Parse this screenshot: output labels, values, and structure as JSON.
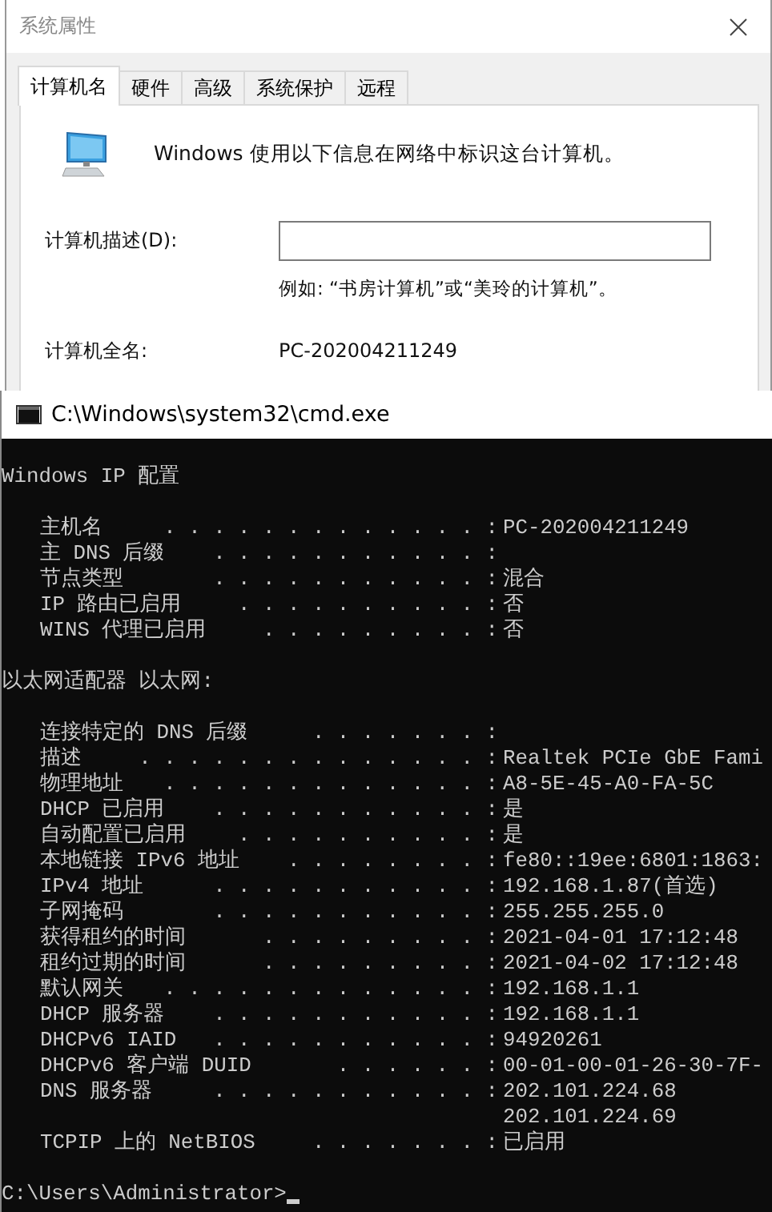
{
  "dialog": {
    "title": "系统属性",
    "tabs": [
      {
        "label": "计算机名",
        "selected": true
      },
      {
        "label": "硬件",
        "selected": false
      },
      {
        "label": "高级",
        "selected": false
      },
      {
        "label": "系统保护",
        "selected": false
      },
      {
        "label": "远程",
        "selected": false
      }
    ],
    "intro": "Windows 使用以下信息在网络中标识这台计算机。",
    "description_label": "计算机描述(D):",
    "example": "例如: “书房计算机”或“美玲的计算机”。",
    "full_name_label": "计算机全名:",
    "full_name": "PC-202004211249"
  },
  "console": {
    "title": "C:\\Windows\\system32\\cmd.exe",
    "lines": [
      {
        "kind": "blank"
      },
      {
        "kind": "heading",
        "text": "Windows IP 配置"
      },
      {
        "kind": "blank"
      },
      {
        "kind": "entry",
        "label": "主机名",
        "leader": ". . . . . . . . . . . . . :",
        "value": "PC-202004211249"
      },
      {
        "kind": "entry",
        "label": "主 DNS 后缀",
        "leader": ". . . . . . . . . . . :"
      },
      {
        "kind": "entry",
        "label": "节点类型",
        "leader": ". . . . . . . . . . . :",
        "value": "混合"
      },
      {
        "kind": "entry",
        "label": "IP 路由已启用",
        "leader": ". . . . . . . . . . :",
        "value": "否"
      },
      {
        "kind": "entry",
        "label": "WINS 代理已启用",
        "leader": ". . . . . . . . . :",
        "value": "否"
      },
      {
        "kind": "blank"
      },
      {
        "kind": "heading",
        "text": "以太网适配器 以太网:"
      },
      {
        "kind": "blank"
      },
      {
        "kind": "entry",
        "label": "连接特定的 DNS 后缀",
        "leader": ". . . . . . . :"
      },
      {
        "kind": "entry",
        "label": "描述",
        "leader": ". . . . . . . . . . . . . . :",
        "value": "Realtek PCIe GbE Fami"
      },
      {
        "kind": "entry",
        "label": "物理地址",
        "leader": ". . . . . . . . . . . . . :",
        "value": "A8-5E-45-A0-FA-5C"
      },
      {
        "kind": "entry",
        "label": "DHCP 已启用",
        "leader": ". . . . . . . . . . . :",
        "value": "是"
      },
      {
        "kind": "entry",
        "label": "自动配置已启用",
        "leader": ". . . . . . . . . . :",
        "value": "是"
      },
      {
        "kind": "entry",
        "label": "本地链接 IPv6 地址",
        "leader": ". . . . . . . . :",
        "value": "fe80::19ee:6801:1863:"
      },
      {
        "kind": "entry",
        "label": "IPv4 地址",
        "leader": ". . . . . . . . . . . :",
        "value": "192.168.1.87(首选)"
      },
      {
        "kind": "entry",
        "label": "子网掩码",
        "leader": ". . . . . . . . . . . :",
        "value": "255.255.255.0"
      },
      {
        "kind": "entry",
        "label": "获得租约的时间",
        "leader": ". . . . . . . . . :",
        "value": "2021-04-01 17:12:48"
      },
      {
        "kind": "entry",
        "label": "租约过期的时间",
        "leader": ". . . . . . . . . :",
        "value": "2021-04-02 17:12:48"
      },
      {
        "kind": "entry",
        "label": "默认网关",
        "leader": ". . . . . . . . . . . . . :",
        "value": "192.168.1.1"
      },
      {
        "kind": "entry",
        "label": "DHCP 服务器",
        "leader": ". . . . . . . . . . . :",
        "value": "192.168.1.1"
      },
      {
        "kind": "entry",
        "label": "DHCPv6 IAID",
        "leader": ". . . . . . . . . . . :",
        "value": "94920261"
      },
      {
        "kind": "entry",
        "label": "DHCPv6 客户端 DUID",
        "leader": ". . . . . . :",
        "value": "00-01-00-01-26-30-7F-"
      },
      {
        "kind": "entry",
        "label": "DNS 服务器",
        "leader": ". . . . . . . . . . . :",
        "value": "202.101.224.68"
      },
      {
        "kind": "continuation",
        "value": "202.101.224.69"
      },
      {
        "kind": "entry",
        "label": "TCPIP 上的 NetBIOS",
        "leader": ". . . . . . . :",
        "value": "已启用"
      },
      {
        "kind": "blank"
      },
      {
        "kind": "prompt",
        "text": "C:\\Users\\Administrator>"
      }
    ]
  }
}
